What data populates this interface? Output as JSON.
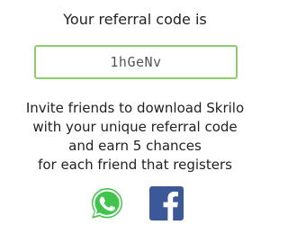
{
  "referral": {
    "heading": "Your referral code is",
    "code": "1hGeNv"
  },
  "invite": {
    "lines": [
      "Invite friends to download Skrilo",
      "with your unique referral code",
      "and earn 5 chances",
      "for each friend that registers"
    ]
  },
  "share": {
    "whatsapp_icon": "whatsapp-icon",
    "facebook_icon": "facebook-icon"
  },
  "colors": {
    "accent_border": "#8ccf6a",
    "whatsapp_green": "#3ec54a",
    "facebook_blue": "#3b5998"
  }
}
